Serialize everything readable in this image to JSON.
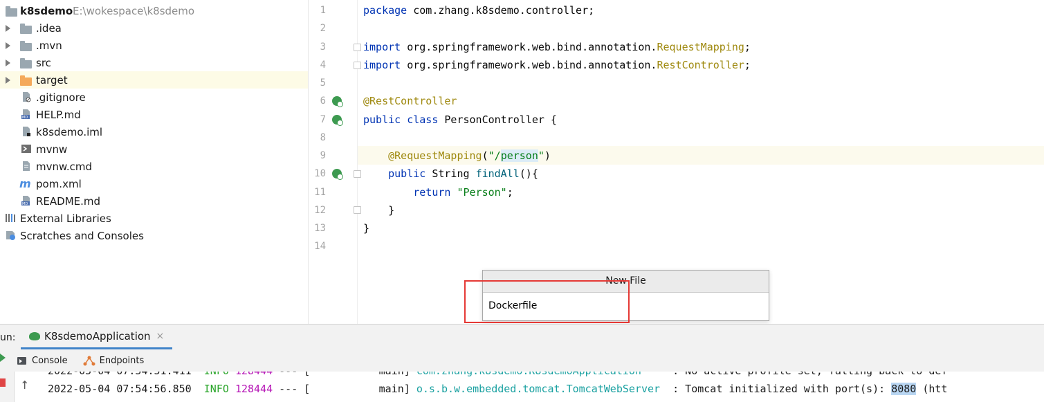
{
  "project": {
    "root_name": "k8sdemo",
    "root_path": "E:\\wokespace\\k8sdemo",
    "items": [
      {
        "label": "k8sdemo",
        "kind": "root-folder"
      },
      {
        "label": ".idea",
        "kind": "folder"
      },
      {
        "label": ".mvn",
        "kind": "folder"
      },
      {
        "label": "src",
        "kind": "folder"
      },
      {
        "label": "target",
        "kind": "folder-excluded"
      },
      {
        "label": ".gitignore",
        "kind": "file"
      },
      {
        "label": "HELP.md",
        "kind": "markdown"
      },
      {
        "label": "k8sdemo.iml",
        "kind": "file"
      },
      {
        "label": "mvnw",
        "kind": "script"
      },
      {
        "label": "mvnw.cmd",
        "kind": "file"
      },
      {
        "label": "pom.xml",
        "kind": "maven"
      },
      {
        "label": "README.md",
        "kind": "markdown"
      },
      {
        "label": "External Libraries",
        "kind": "libraries"
      },
      {
        "label": "Scratches and Consoles",
        "kind": "scratches"
      }
    ]
  },
  "editor": {
    "line_numbers": [
      "1",
      "2",
      "3",
      "4",
      "5",
      "6",
      "7",
      "8",
      "9",
      "10",
      "11",
      "12",
      "13",
      "14"
    ],
    "lines": {
      "l1_kw": "package",
      "l1_rest": " com.zhang.k8sdemo.controller;",
      "l3_kw": "import",
      "l3_pkg": " org.springframework.web.bind.annotation.",
      "l3_cls": "RequestMapping",
      "l3_end": ";",
      "l4_kw": "import",
      "l4_pkg": " org.springframework.web.bind.annotation.",
      "l4_cls": "RestController",
      "l4_end": ";",
      "l6_ann": "@RestController",
      "l7_kw1": "public",
      "l7_kw2": "class",
      "l7_rest": " PersonController {",
      "l9_ann": "@RequestMapping",
      "l9_open": "(",
      "l9_str1": "\"/",
      "l9_hl": "person",
      "l9_str2": "\"",
      "l9_close": ")",
      "l10_kw": "public",
      "l10_type": " String ",
      "l10_fn": "findAll",
      "l10_rest": "(){",
      "l11_kw": "return",
      "l11_str": "\"Person\"",
      "l11_end": ";",
      "l12": "}",
      "l13": "}"
    }
  },
  "dialog": {
    "title": "New File",
    "value": "Dockerfile"
  },
  "run_panel": {
    "run_label": "un:",
    "tab_label": "K8sdemoApplication",
    "close_glyph": "×",
    "subtabs": [
      "Console",
      "Endpoints"
    ],
    "up_glyph": "↑",
    "log_lines": [
      {
        "ts": "2022-05-04 07:54:51.411",
        "level": "INFO",
        "pid": "128444",
        "sep": " --- [",
        "thread": "           main]",
        "logger": "com.zhang.k8sdemo.K8sdemoApplication",
        "msg": "     : No active profile set, falling back to def"
      },
      {
        "ts": "2022-05-04 07:54:56.850",
        "level": "INFO",
        "pid": "128444",
        "sep": " --- [",
        "thread": "           main]",
        "logger": "o.s.b.w.embedded.tomcat.TomcatWebServer",
        "msg_pre": "  : Tomcat initialized with port(s): ",
        "port": "8080",
        "msg_post": " (htt"
      }
    ]
  },
  "colors": {
    "keyword": "#0033b3",
    "annotation": "#9e880d",
    "string": "#067d17",
    "highlight_border": "#e53935"
  }
}
